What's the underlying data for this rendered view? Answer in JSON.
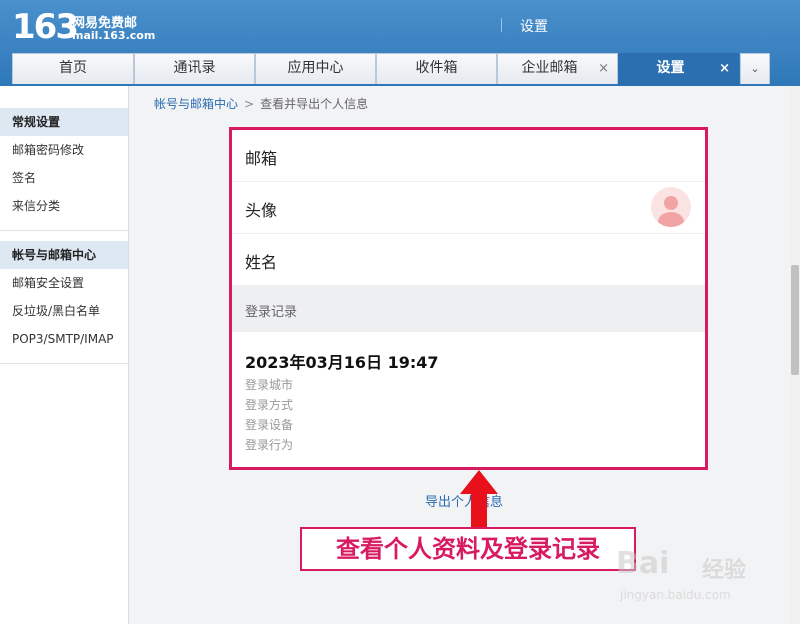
{
  "header": {
    "logo_number": "163",
    "logo_cn": "网易免费邮",
    "logo_url": "mail.163.com",
    "title": "设置"
  },
  "tabs": [
    {
      "label": "首页"
    },
    {
      "label": "通讯录"
    },
    {
      "label": "应用中心"
    },
    {
      "label": "收件箱"
    },
    {
      "label": "企业邮箱",
      "closable": true
    },
    {
      "label": "设置",
      "closable": true,
      "active": true
    }
  ],
  "tab_close_glyph": "×",
  "tab_more_glyph": "⌄",
  "sidebar": {
    "section1": {
      "title": "常规设置",
      "items": [
        "邮箱密码修改",
        "签名",
        "来信分类"
      ]
    },
    "section2": {
      "title": "帐号与邮箱中心",
      "items": [
        "邮箱安全设置",
        "反垃圾/黑白名单",
        "POP3/SMTP/IMAP"
      ]
    }
  },
  "breadcrumb": {
    "parent": "帐号与邮箱中心",
    "separator": ">",
    "current": "查看并导出个人信息"
  },
  "profile": {
    "mailbox_label": "邮箱",
    "avatar_label": "头像",
    "name_label": "姓名"
  },
  "login_record": {
    "section_title": "登录记录",
    "time": "2023年03月16日 19:47",
    "city_label": "登录城市",
    "method_label": "登录方式",
    "device_label": "登录设备",
    "action_label": "登录行为"
  },
  "export_link": "导出个人信息",
  "annotation": "查看个人资料及登录记录",
  "watermark": {
    "brand": "Bai",
    "cn": "经验",
    "url": "jingyan.baidu.com"
  },
  "colors": {
    "accent": "#2c6fb0",
    "highlight": "#d81b60"
  }
}
